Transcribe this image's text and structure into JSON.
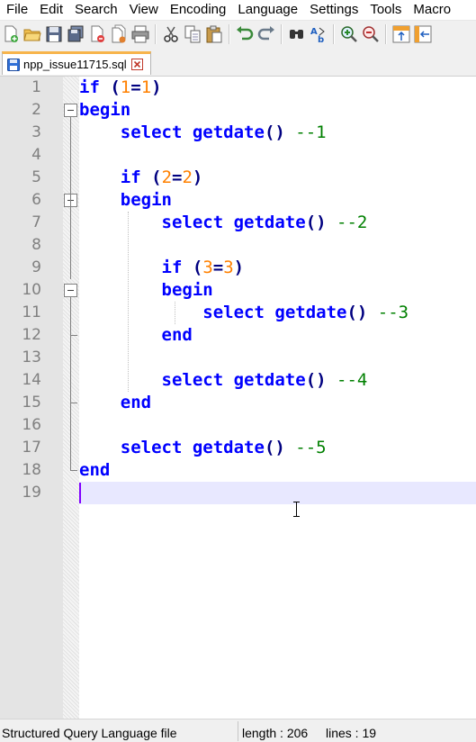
{
  "menu": [
    "File",
    "Edit",
    "Search",
    "View",
    "Encoding",
    "Language",
    "Settings",
    "Tools",
    "Macro"
  ],
  "toolbar": {
    "groups": [
      [
        "new-file-icon",
        "open-file-icon",
        "save-icon",
        "save-all-icon",
        "close-icon",
        "close-all-icon",
        "print-icon"
      ],
      [
        "cut-icon",
        "copy-icon",
        "paste-icon"
      ],
      [
        "undo-icon",
        "redo-icon"
      ],
      [
        "find-icon",
        "replace-icon"
      ],
      [
        "zoom-in-icon",
        "zoom-out-icon"
      ],
      [
        "sync-vertical-icon",
        "sync-horizontal-icon"
      ]
    ]
  },
  "tab": {
    "label": "npp_issue11715.sql",
    "close_icon": "tab-close-icon"
  },
  "editor": {
    "current_line": 19,
    "lines": [
      [
        [
          "kw",
          "if"
        ],
        [
          "t",
          " "
        ],
        [
          "op",
          "("
        ],
        [
          "num",
          "1"
        ],
        [
          "op",
          "="
        ],
        [
          "num",
          "1"
        ],
        [
          "op",
          ")"
        ]
      ],
      [
        [
          "kw",
          "begin"
        ]
      ],
      [
        [
          "t",
          "    "
        ],
        [
          "kw",
          "select"
        ],
        [
          "t",
          " "
        ],
        [
          "fn",
          "getdate"
        ],
        [
          "op",
          "()"
        ],
        [
          "t",
          " "
        ],
        [
          "com",
          "--1"
        ]
      ],
      [],
      [
        [
          "t",
          "    "
        ],
        [
          "kw",
          "if"
        ],
        [
          "t",
          " "
        ],
        [
          "op",
          "("
        ],
        [
          "num",
          "2"
        ],
        [
          "op",
          "="
        ],
        [
          "num",
          "2"
        ],
        [
          "op",
          ")"
        ]
      ],
      [
        [
          "t",
          "    "
        ],
        [
          "kw",
          "begin"
        ]
      ],
      [
        [
          "t",
          "        "
        ],
        [
          "kw",
          "select"
        ],
        [
          "t",
          " "
        ],
        [
          "fn",
          "getdate"
        ],
        [
          "op",
          "()"
        ],
        [
          "t",
          " "
        ],
        [
          "com",
          "--2"
        ]
      ],
      [],
      [
        [
          "t",
          "        "
        ],
        [
          "kw",
          "if"
        ],
        [
          "t",
          " "
        ],
        [
          "op",
          "("
        ],
        [
          "num",
          "3"
        ],
        [
          "op",
          "="
        ],
        [
          "num",
          "3"
        ],
        [
          "op",
          ")"
        ]
      ],
      [
        [
          "t",
          "        "
        ],
        [
          "kw",
          "begin"
        ]
      ],
      [
        [
          "t",
          "            "
        ],
        [
          "kw",
          "select"
        ],
        [
          "t",
          " "
        ],
        [
          "fn",
          "getdate"
        ],
        [
          "op",
          "()"
        ],
        [
          "t",
          " "
        ],
        [
          "com",
          "--3"
        ]
      ],
      [
        [
          "t",
          "        "
        ],
        [
          "kw",
          "end"
        ]
      ],
      [],
      [
        [
          "t",
          "        "
        ],
        [
          "kw",
          "select"
        ],
        [
          "t",
          " "
        ],
        [
          "fn",
          "getdate"
        ],
        [
          "op",
          "()"
        ],
        [
          "t",
          " "
        ],
        [
          "com",
          "--4"
        ]
      ],
      [
        [
          "t",
          "    "
        ],
        [
          "kw",
          "end"
        ]
      ],
      [],
      [
        [
          "t",
          "    "
        ],
        [
          "kw",
          "select"
        ],
        [
          "t",
          " "
        ],
        [
          "fn",
          "getdate"
        ],
        [
          "op",
          "()"
        ],
        [
          "t",
          " "
        ],
        [
          "com",
          "--5"
        ]
      ],
      [
        [
          "kw",
          "end"
        ]
      ],
      []
    ],
    "fold_markers": [
      2,
      6,
      10
    ]
  },
  "status": {
    "language": "Structured Query Language file",
    "length": "length : 206",
    "lines": "lines : 19"
  },
  "colors": {
    "keyword": "#0000ff",
    "number": "#ff8000",
    "operator": "#000080",
    "comment": "#008000",
    "current_line": "#e8e8ff",
    "caret": "#8000ff",
    "tab_accent": "#f7b44b"
  }
}
